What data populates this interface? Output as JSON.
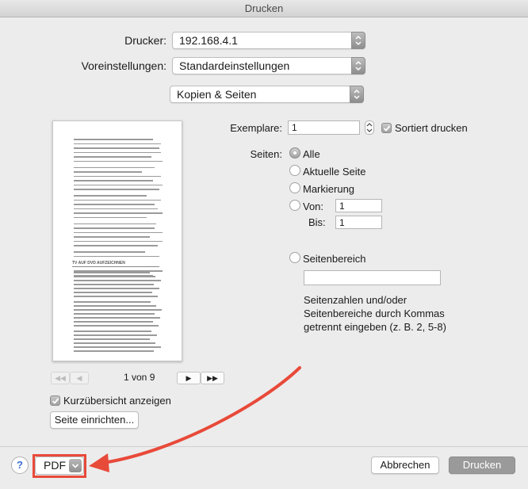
{
  "window": {
    "title": "Drucken"
  },
  "printer": {
    "label": "Drucker:",
    "value": "192.168.4.1"
  },
  "presets": {
    "label": "Voreinstellungen:",
    "value": "Standardeinstellungen"
  },
  "section": {
    "value": "Kopien & Seiten"
  },
  "preview": {
    "heading": "TV AUF DVD AUFZEICHNEN",
    "page_indicator": "1 von 9",
    "first_label": "◀◀",
    "prev_label": "◀",
    "next_label": "▶",
    "last_label": "▶▶"
  },
  "copies": {
    "label": "Exemplare:",
    "value": "1",
    "collate_label": "Sortiert drucken",
    "collate_checked": true
  },
  "pages": {
    "label": "Seiten:",
    "options": [
      "Alle",
      "Aktuelle Seite",
      "Markierung",
      "Von:"
    ],
    "from_value": "1",
    "to_label": "Bis:",
    "to_value": "1",
    "range_label": "Seitenbereich",
    "range_value": "",
    "hint_lines": [
      "Seitenzahlen und/oder",
      "Seitenbereiche durch Kommas",
      "getrennt eingeben (z. B. 2, 5-8)"
    ]
  },
  "show_details": {
    "label": "Kurzübersicht anzeigen",
    "checked": true
  },
  "page_setup": {
    "label": "Seite einrichten..."
  },
  "footer": {
    "help_label": "?",
    "pdf_label": "PDF",
    "cancel_label": "Abbrechen",
    "print_label": "Drucken"
  },
  "colors": {
    "highlight": "#e84a3a",
    "help_accent": "#3a6fd6"
  }
}
